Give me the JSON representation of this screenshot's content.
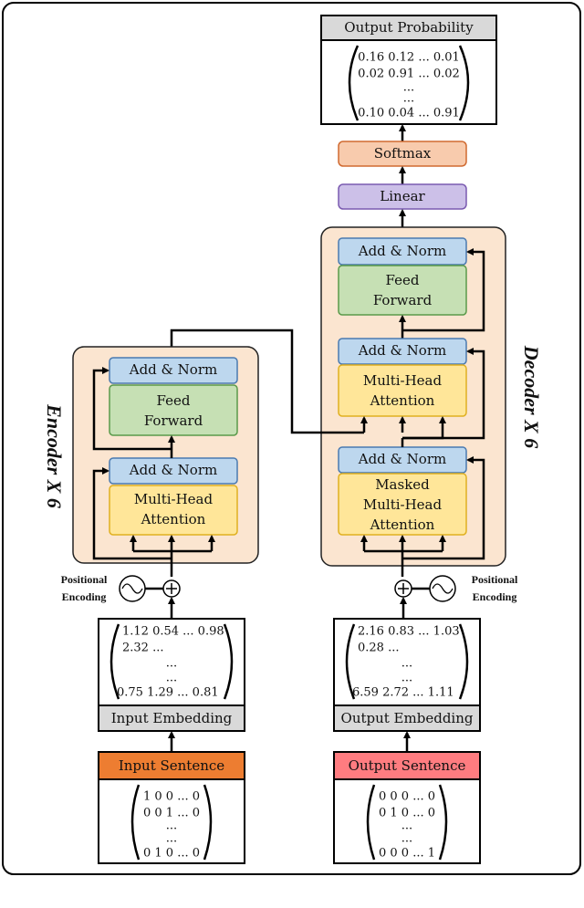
{
  "output_probability": {
    "title": "Output Probability",
    "rows": [
      "0.16 0.12 ... 0.01",
      "0.02 0.91 ... 0.02",
      "...",
      "...",
      "0.10 0.04 ... 0.91"
    ]
  },
  "softmax": "Softmax",
  "linear": "Linear",
  "decoder": {
    "label": "Decoder X 6",
    "add_norm_top": "Add & Norm",
    "feed_forward": [
      "Feed",
      "Forward"
    ],
    "add_norm_mid": "Add & Norm",
    "mha": [
      "Multi-Head",
      "Attention"
    ],
    "add_norm_bottom": "Add & Norm",
    "masked_mha": [
      "Masked",
      "Multi-Head",
      "Attention"
    ]
  },
  "encoder": {
    "label": "Encoder X 6",
    "add_norm_top": "Add & Norm",
    "feed_forward": [
      "Feed",
      "Forward"
    ],
    "add_norm_bottom": "Add & Norm",
    "mha": [
      "Multi-Head",
      "Attention"
    ]
  },
  "positional_encoding": [
    "Positional",
    "Encoding"
  ],
  "input_embedding": {
    "title": "Input Embedding",
    "rows": [
      "1.12 0.54  ... 0.98",
      "2.32  ...",
      "...",
      "...",
      "0.75 1.29  ... 0.81"
    ]
  },
  "output_embedding": {
    "title": "Output Embedding",
    "rows": [
      "2.16 0.83  ... 1.03",
      "0.28 ...",
      "...",
      "...",
      "6.59 2.72  ... 1.11"
    ]
  },
  "input_sentence": {
    "title": "Input Sentence",
    "rows": [
      "1  0  0  ...  0",
      "0  0  1  ...  0",
      "...",
      "...",
      "0  1  0  ...  0"
    ]
  },
  "output_sentence": {
    "title": "Output Sentence",
    "rows": [
      "0  0  0  ...  0",
      "0  1  0  ...  0",
      "...",
      "...",
      "0  0  0  ...  1"
    ]
  },
  "colors": {
    "add_norm": "#bdd7ee",
    "feed_forward": "#c6e0b4",
    "attention": "#ffe699",
    "stack_bg": "#fbe5d0",
    "softmax": "#f8cbad",
    "linear": "#ccc0e8",
    "input_sentence": "#ed7d31",
    "output_sentence": "#ff7c80",
    "header_gray": "#d9d9d9"
  }
}
